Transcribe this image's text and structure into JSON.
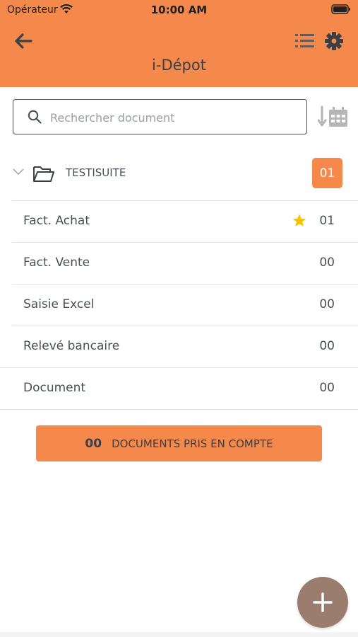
{
  "status_bar": {
    "carrier": "Opérateur",
    "time": "10:00 AM"
  },
  "header": {
    "title": "i-Dépot"
  },
  "search": {
    "placeholder": "Rechercher document",
    "value": ""
  },
  "folder": {
    "name": "TESTISUITE",
    "count": "01"
  },
  "categories": [
    {
      "label": "Fact. Achat",
      "count": "01",
      "starred": true
    },
    {
      "label": "Fact. Vente",
      "count": "00",
      "starred": false
    },
    {
      "label": "Saisie Excel",
      "count": "00",
      "starred": false
    },
    {
      "label": "Relevé bancaire",
      "count": "00",
      "starred": false
    },
    {
      "label": "Document",
      "count": "00",
      "starred": false
    }
  ],
  "footer_button": {
    "count": "00",
    "label": "DOCUMENTS PRIS EN COMPTE"
  },
  "colors": {
    "accent": "#f4894b",
    "fab": "#9b7d6f",
    "star": "#f5c400"
  }
}
